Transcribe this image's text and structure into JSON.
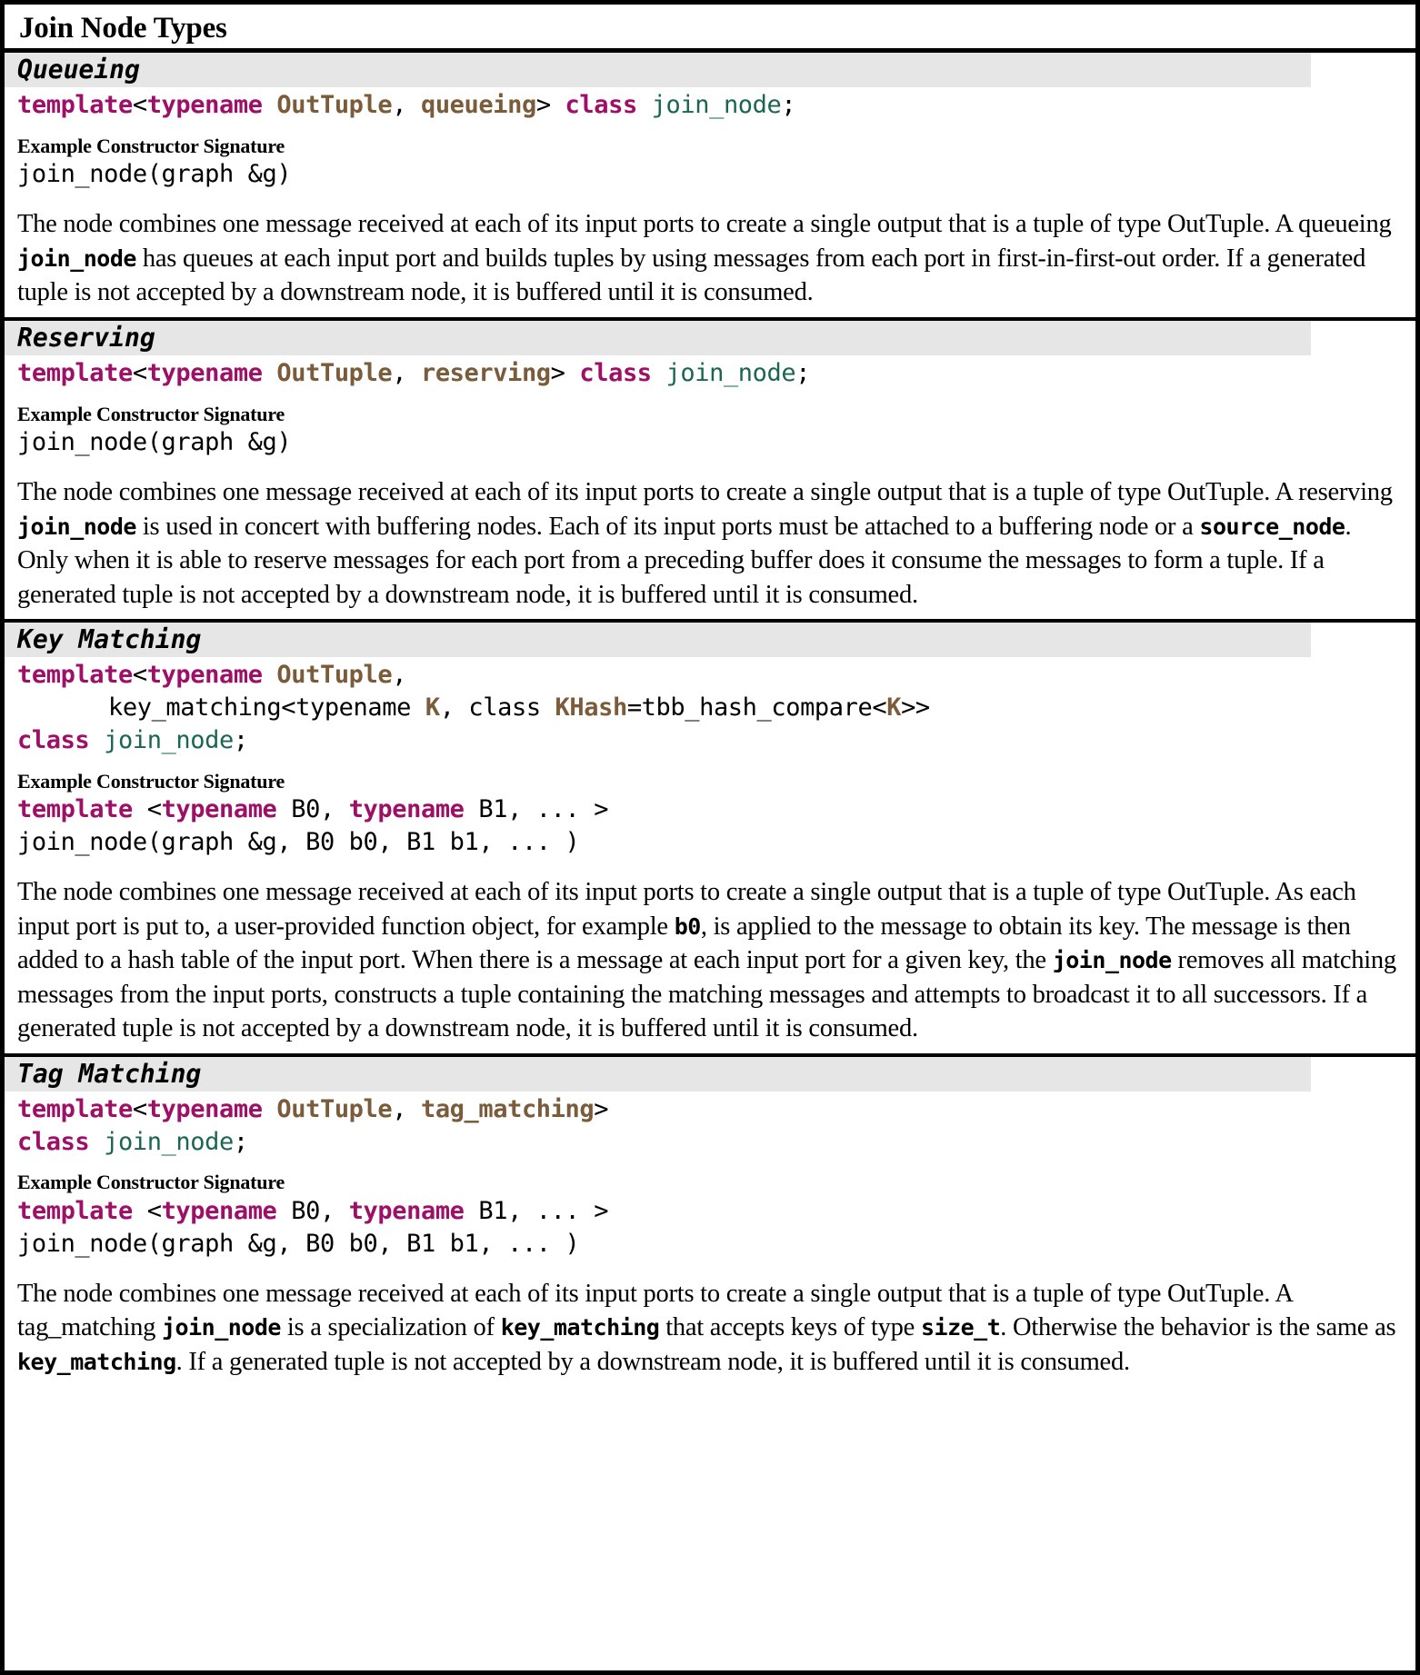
{
  "title": "Join Node Types",
  "labels": {
    "example_constructor": "Example Constructor Signature"
  },
  "sections": [
    {
      "heading": "Queueing",
      "signature": {
        "line1": {
          "template_kw": "template",
          "lt": "<",
          "typename_kw": "typename",
          "type_param": "OutTuple",
          "comma": ", ",
          "policy": "queueing",
          "gt": "> ",
          "class_kw": "class",
          "space": " ",
          "class_name": "join_node",
          "semicolon": ";"
        }
      },
      "constructor": {
        "line1": "join_node(graph &g)"
      },
      "description": {
        "part1": "The node combines one message received at each of its input ports to create a single output that is a tuple of type OutTuple. A queueing ",
        "code1": "join_node",
        "part2": " has queues at each input port and builds tuples by using messages from each port in first-in-first-out order. If a generated tuple is not accepted by a downstream node, it is buffered until it is consumed."
      }
    },
    {
      "heading": "Reserving",
      "signature": {
        "line1": {
          "template_kw": "template",
          "lt": "<",
          "typename_kw": "typename",
          "type_param": "OutTuple",
          "comma": ", ",
          "policy": "reserving",
          "gt": "> ",
          "class_kw": "class",
          "space": " ",
          "class_name": "join_node",
          "semicolon": ";"
        }
      },
      "constructor": {
        "line1": "join_node(graph &g)"
      },
      "description": {
        "part1": "The node combines one message received at each of its input ports to create a single output that is a tuple of type OutTuple. A reserving ",
        "code1": "join_node",
        "part2": " is used in concert with buffering nodes.   Each of its input ports must be attached to a buffering node or a ",
        "code2": "source_node",
        "part3": ".   Only when it is able to reserve messages for each port from a preceding buffer does it consume the messages to form a tuple. If a generated tuple is not accepted by a downstream node, it is buffered until it is consumed."
      }
    },
    {
      "heading": "Key Matching",
      "signature": {
        "line1": {
          "template_kw": "template",
          "lt": "<",
          "typename_kw": "typename",
          "type_param": "OutTuple",
          "comma": ","
        },
        "line2": {
          "prefix": "key_matching<typename ",
          "k_param": "K",
          "mid": ", class ",
          "khash_param": "KHash",
          "suffix": "=tbb_hash_compare<",
          "k_param2": "K",
          "tail": ">>"
        },
        "line3": {
          "class_kw": "class",
          "space": " ",
          "class_name": "join_node",
          "semicolon": ";"
        }
      },
      "constructor": {
        "line1": {
          "template_kw": "template",
          "space1": " <",
          "typename_kw1": "typename",
          "b0": " B0, ",
          "typename_kw2": "typename",
          "b1": " B1, ... >"
        },
        "line2": "join_node(graph &g, B0 b0, B1 b1, ... )"
      },
      "description": {
        "part1": "The node combines one message received at each of its input ports to create a single output that is a tuple of type OutTuple. As each input port is put to, a user-provided function object, for example ",
        "code1": "b0",
        "part2": ", is applied to the message to obtain its key. The message is then added to a hash table of the input port. When there is a message at each input port for a given key, the ",
        "code2": "join_node",
        "part3": " removes all matching messages from the input ports, constructs a tuple containing the matching messages and attempts to broadcast it to all successors. If a generated tuple is not accepted by a downstream node, it is buffered until it is consumed."
      }
    },
    {
      "heading": "Tag Matching",
      "signature": {
        "line1": {
          "template_kw": "template",
          "lt": "<",
          "typename_kw": "typename",
          "type_param": "OutTuple",
          "comma": ", ",
          "policy": "tag_matching",
          "gt": ">"
        },
        "line2": {
          "class_kw": "class",
          "space": " ",
          "class_name": "join_node",
          "semicolon": ";"
        }
      },
      "constructor": {
        "line1": {
          "template_kw": "template",
          "space1": " <",
          "typename_kw1": "typename",
          "b0": " B0, ",
          "typename_kw2": "typename",
          "b1": " B1, ... >"
        },
        "line2": "join_node(graph &g, B0 b0, B1 b1, ... )"
      },
      "description": {
        "part1": "The node combines one message received at each of its input ports to create a single output that is a tuple of type OutTuple. A tag_matching ",
        "code1": "join_node",
        "part2": " is a specialization of ",
        "code2": "key_matching",
        "part3": " that accepts keys of type ",
        "code3": "size_t",
        "part4": ". Otherwise the behavior is the same as ",
        "code4": "key_matching",
        "part5": ". If a generated tuple is not accepted by a downstream node, it is buffered until it is consumed."
      }
    }
  ],
  "colors": {
    "keyword": "#9e1068",
    "type_param": "#7a5c3a",
    "class_name": "#1a6650",
    "header_band": "#e6e6e6",
    "border": "#000000"
  }
}
